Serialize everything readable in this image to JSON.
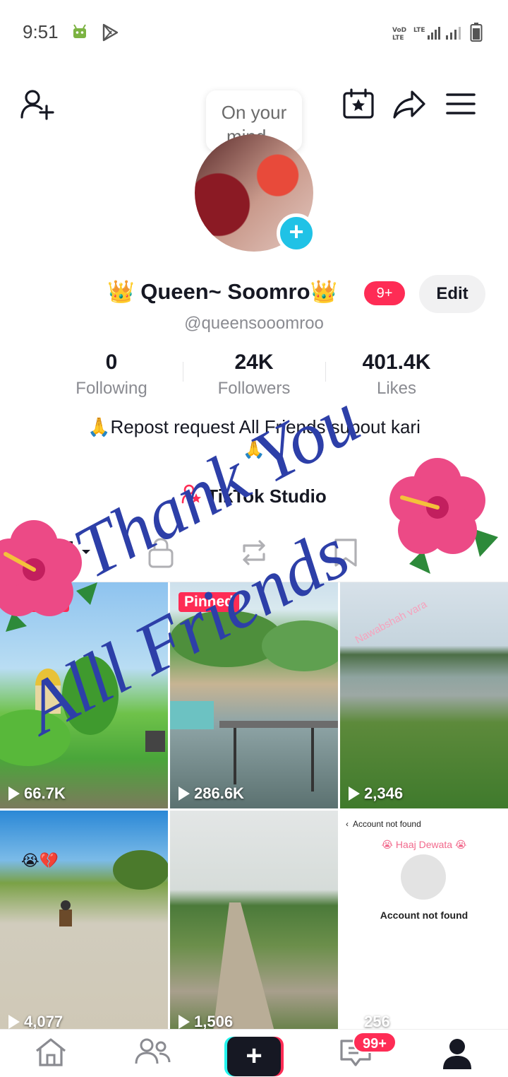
{
  "status_bar": {
    "time": "9:51",
    "left_icons": [
      "android-icon",
      "play-store-icon"
    ],
    "right_icons": [
      "volte-icon",
      "lte-signal-icon",
      "signal-bars-icon",
      "battery-icon"
    ],
    "volte_label": "VoLTE",
    "lte_label": "LTE"
  },
  "header": {
    "mind_prompt_line1": "On your",
    "mind_prompt_line2": "mind..."
  },
  "profile": {
    "name": "👑 Queen~ Soomro👑",
    "notification_badge": "9+",
    "edit_label": "Edit",
    "handle": "@queensooomroo",
    "stats": [
      {
        "value": "0",
        "label": "Following"
      },
      {
        "value": "24K",
        "label": "Followers"
      },
      {
        "value": "401.4K",
        "label": "Likes"
      }
    ],
    "bio": "🙏Repost request All Friends supout kari",
    "bio_line2": "🙏",
    "studio_label": "TikTok Studio"
  },
  "overlay": {
    "line1": "Thank You",
    "line2": "Alll Friends"
  },
  "videos": [
    {
      "views": "66.7K",
      "pinned_label": "Pinned"
    },
    {
      "views": "286.6K",
      "pinned_label": "Pinned"
    },
    {
      "views": "2,346",
      "caption": "Nawabshah vara"
    },
    {
      "views": "4,077",
      "emoji": "😭💔"
    },
    {
      "views": "1,506"
    },
    {
      "views": "256",
      "top_label": "Account not found",
      "pink_caption": "😭 Haaj Dewata 😭",
      "center_label": "Account not found"
    }
  ],
  "bottom_nav": {
    "inbox_badge": "99+"
  },
  "colors": {
    "accent": "#fe2c55",
    "cyan": "#25f4ee",
    "add_button": "#20c2e6",
    "overlay_text": "#2d3fa8"
  }
}
